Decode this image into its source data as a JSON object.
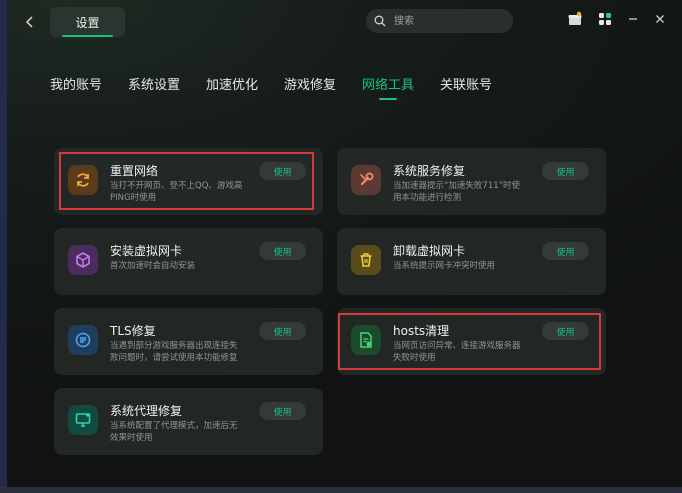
{
  "titlebar": {
    "back_icon": "chevron-left-icon",
    "active_tab": "设置",
    "search_placeholder": "搜索",
    "icons": [
      "gift-box-icon",
      "grid-apps-icon",
      "minimize-icon",
      "close-icon"
    ]
  },
  "tabs": [
    {
      "label": "我的账号",
      "active": false
    },
    {
      "label": "系统设置",
      "active": false
    },
    {
      "label": "加速优化",
      "active": false
    },
    {
      "label": "游戏修复",
      "active": false
    },
    {
      "label": "网络工具",
      "active": true
    },
    {
      "label": "关联账号",
      "active": false
    }
  ],
  "tools": [
    {
      "title": "重置网络",
      "desc": "当打不开网页、登不上QQ、游戏高PING时使用",
      "button": "使用",
      "icon": "refresh-icon",
      "color": "#d88a2c",
      "highlighted": true
    },
    {
      "title": "系统服务修复",
      "desc": "当加速器提示“加速失败711”时使用本功能进行检测",
      "button": "使用",
      "icon": "wrench-icon",
      "color": "#e07b5a",
      "highlighted": false
    },
    {
      "title": "安装虚拟网卡",
      "desc": "首次加速时会自动安装",
      "button": "使用",
      "icon": "cube-icon",
      "color": "#b66ae0",
      "highlighted": false
    },
    {
      "title": "卸载虚拟网卡",
      "desc": "当系统提示网卡冲突时使用",
      "button": "使用",
      "icon": "trash-icon",
      "color": "#e3c23a",
      "highlighted": false
    },
    {
      "title": "TLS修复",
      "desc": "当遇到部分游戏服务器出现连接失败问题时，请尝试使用本功能修复",
      "button": "使用",
      "icon": "tls-icon",
      "color": "#3d8fe6",
      "highlighted": false
    },
    {
      "title": "hosts清理",
      "desc": "当网页访问异常、连接游戏服务器失败时使用",
      "button": "使用",
      "icon": "file-clean-icon",
      "color": "#3ecf6e",
      "highlighted": true
    },
    {
      "title": "系统代理修复",
      "desc": "当系统配置了代理模式，加速后无效果时使用",
      "button": "使用",
      "icon": "monitor-icon",
      "color": "#28c7a5",
      "highlighted": false
    }
  ]
}
